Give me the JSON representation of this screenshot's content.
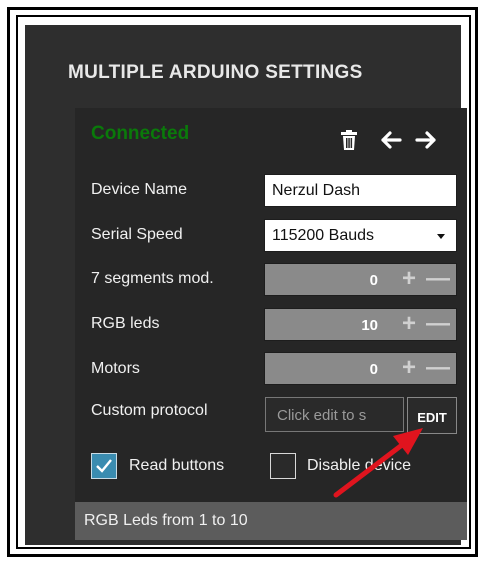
{
  "header": {
    "title": "MULTIPLE ARDUINO SETTINGS"
  },
  "device": {
    "status": "Connected",
    "status_color": "#0a7a0a",
    "toolbar": {
      "delete_icon": "trash-icon",
      "prev_glyph": "🡐",
      "next_glyph": "🡒"
    },
    "fields": {
      "device_name": {
        "label": "Device Name",
        "value": "Nerzul Dash"
      },
      "serial_speed": {
        "label": "Serial Speed",
        "value": "115200 Bauds"
      },
      "segments": {
        "label": "7 segments mod.",
        "value": "0"
      },
      "rgb_leds": {
        "label": "RGB leds",
        "value": "10"
      },
      "motors": {
        "label": "Motors",
        "value": "0"
      },
      "custom_protocol": {
        "label": "Custom protocol",
        "placeholder": "Click edit to s",
        "button": "EDIT"
      }
    },
    "stepper_glyphs": {
      "plus": "+",
      "minus": "—"
    },
    "checkboxes": {
      "read_buttons": {
        "label": "Read buttons",
        "checked": true
      },
      "disable_device": {
        "label": "Disable device",
        "checked": false
      }
    },
    "footer": "RGB Leds from 1 to 10"
  },
  "accent_colors": {
    "annotation_arrow": "#e0141e",
    "checkbox_checked": "#3a8cb0"
  }
}
